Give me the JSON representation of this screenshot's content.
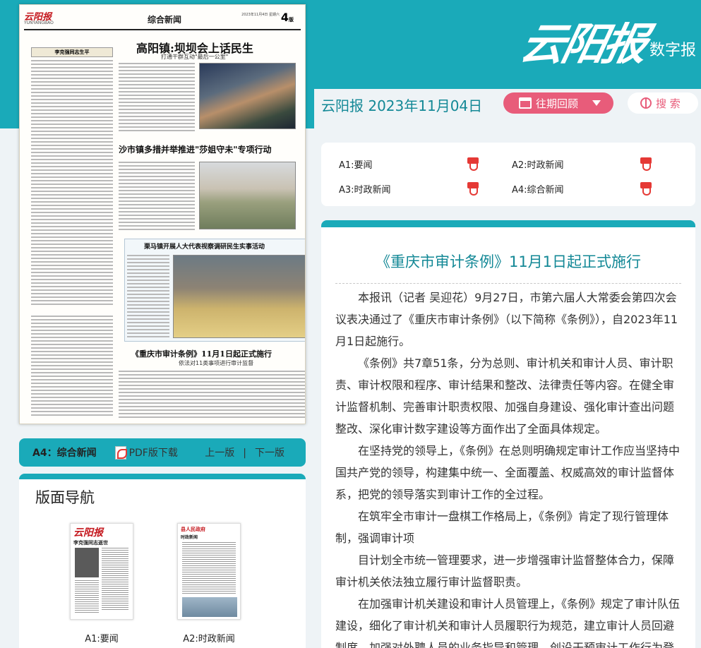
{
  "header": {
    "logo_text": "云阳报",
    "logo_sub": "数字报",
    "date": "云阳报 2023年11月04日",
    "archive_label": "往期回顾",
    "search_label": "搜 索"
  },
  "newspaper": {
    "masthead": "云阳报",
    "masthead_en": "YUNYANGBAO",
    "section": "综合新闻",
    "page_no": "4",
    "page_suffix": "版",
    "meta": "2023年11月4日 星期六",
    "headline1": "高阳镇:坝坝会上话民生",
    "sub1": "打通干群互动\"最后一公里\"",
    "headline2": "沙市镇多措并举推进\"莎姐守未\"专项行动",
    "headline3": "栗马镇开展人大代表视察调研民生实事活动",
    "headline4": "《重庆市审计条例》11月1日起正式施行",
    "sub4": "依法对11类事项进行审计监督",
    "box_label": "李克强同志生平"
  },
  "page_bar": {
    "current": "A4：综合新闻",
    "pdf_download": "PDF版下载",
    "prev": "上一版",
    "divider": "|",
    "next": "下一版"
  },
  "nav": {
    "title": "版面导航",
    "thumbs": [
      {
        "label": "A1:要闻",
        "head": "云阳报",
        "lead": "李克强同志逝世"
      },
      {
        "label": "A2:时政新闻",
        "head": "县人民政府",
        "lead": "时政新闻"
      }
    ]
  },
  "toc": {
    "items": [
      {
        "label": "A1:要闻"
      },
      {
        "label": "A2:时政新闻"
      },
      {
        "label": "A3:时政新闻"
      },
      {
        "label": "A4:综合新闻"
      }
    ]
  },
  "article": {
    "title": "《重庆市审计条例》11月1日起正式施行",
    "paragraphs": [
      "本报讯（记者 吴迎花）9月27日，市第六届人大常委会第四次会议表决通过了《重庆市审计条例》（以下简称《条例》），自2023年11月1日起施行。",
      "《条例》共7章51条，分为总则、审计机关和审计人员、审计职责、审计权限和程序、审计结果和整改、法律责任等内容。在健全审计监督机制、完善审计职责权限、加强自身建设、强化审计查出问题整改、深化审计数字建设等方面作出了全面具体规定。",
      "在坚持党的领导上，《条例》在总则明确规定审计工作应当坚持中国共产党的领导，构建集中统一、全面覆盖、权威高效的审计监督体系，把党的领导落实到审计工作的全过程。",
      "在筑牢全市审计一盘棋工作格局上，《条例》肯定了现行管理体制，强调审计项",
      "目计划全市统一管理要求，进一步增强审计监督整体合力，保障审计机关依法独立履行审计监督职责。",
      "在加强审计机关建设和审计人员管理上，《条例》规定了审计队伍建设，细化了审计机关和审计人员履职行为规范，建立审计人员回避制度，加强对外聘人员的业务指导和管理，创设干预审计工作行为登"
    ]
  },
  "colors": {
    "teal": "#1aaab9",
    "teal_dark": "#138896",
    "pink": "#e85c7a",
    "pdf_red": "#e53935"
  },
  "icons": [
    "calendar-icon",
    "dropdown-arrow-icon",
    "globe-icon",
    "pdf-icon"
  ]
}
